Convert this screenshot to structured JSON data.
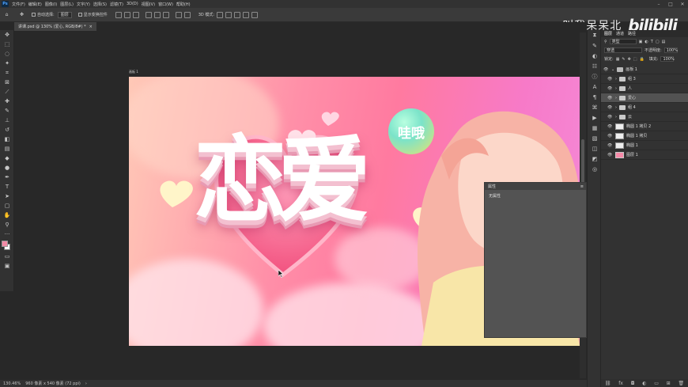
{
  "app": {
    "logo": "Ps"
  },
  "menu": [
    "文件(F)",
    "编辑(E)",
    "图像(I)",
    "图层(L)",
    "文字(Y)",
    "选择(S)",
    "滤镜(T)",
    "3D(D)",
    "视图(V)",
    "窗口(W)",
    "帮助(H)"
  ],
  "options": {
    "auto_select_label": "自动选择:",
    "auto_select_value": "图层",
    "show_transform_label": "显示变换控件",
    "mode3d_label": "3D 模式:"
  },
  "brand": {
    "text": "叫我呆呆北",
    "logo": "bilibili"
  },
  "document": {
    "tab_title": "讲课.psd @ 130% (爱心, RGB/8#) *",
    "artboard_label": "画板 1",
    "art_title": "恋爱",
    "bubble_text": "哇哦"
  },
  "properties": {
    "title": "属性",
    "empty_text": "无属性"
  },
  "status": {
    "zoom": "130.46%",
    "doc_size": "960 像素 x 540 像素 (72 ppi)"
  },
  "layers_panel": {
    "tabs": [
      "图层",
      "通道",
      "路径"
    ],
    "filter_label": "类型",
    "blend_mode": "穿透",
    "opacity_label": "不透明度:",
    "opacity_value": "100%",
    "lock_label": "锁定:",
    "fill_label": "填充:",
    "fill_value": "100%",
    "layers": [
      {
        "name": "画板 1",
        "kind": "artboard",
        "selected": false
      },
      {
        "name": "组 3",
        "kind": "group",
        "selected": false
      },
      {
        "name": "人",
        "kind": "group",
        "selected": false
      },
      {
        "name": "爱心",
        "kind": "group",
        "selected": true
      },
      {
        "name": "组 4",
        "kind": "group",
        "selected": false
      },
      {
        "name": "云",
        "kind": "group",
        "selected": false
      },
      {
        "name": "椭圆 1 拷贝 2",
        "kind": "shape",
        "selected": false
      },
      {
        "name": "椭圆 1 拷贝",
        "kind": "shape",
        "selected": false
      },
      {
        "name": "椭圆 1",
        "kind": "shape",
        "selected": false
      },
      {
        "name": "图层 1",
        "kind": "pixel",
        "selected": false
      }
    ]
  },
  "colors": {
    "foreground": "#f28aa5",
    "background": "#ffffff",
    "accent_pink": "#ff7aa0"
  }
}
